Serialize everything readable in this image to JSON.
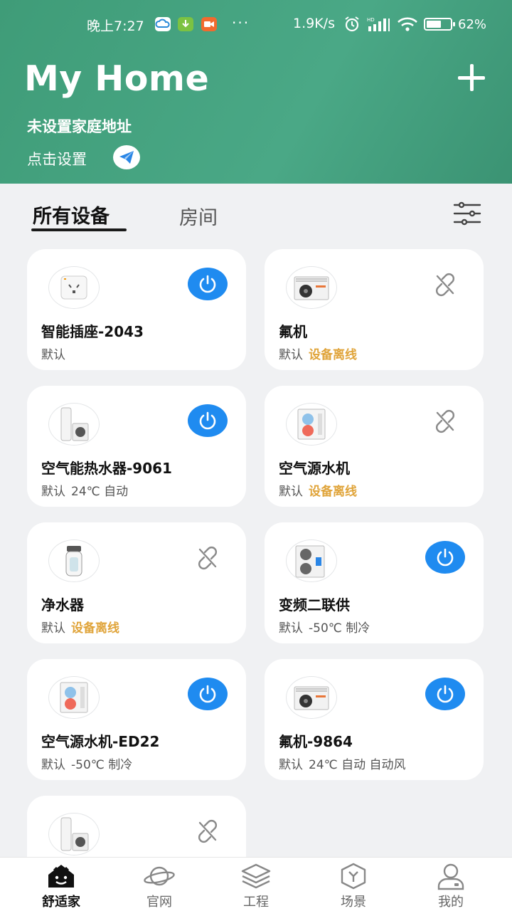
{
  "status_bar": {
    "time": "晚上7:27",
    "dots": "···",
    "speed": "1.9K/s",
    "battery_text": "62%",
    "battery_level": 0.62
  },
  "header": {
    "title": "My Home",
    "address": "未设置家庭地址",
    "setup_label": "点击设置"
  },
  "tabs": {
    "all_devices": "所有设备",
    "rooms": "房间"
  },
  "devices": [
    {
      "name": "智能插座-2043",
      "room": "默认",
      "status": "",
      "extra": "",
      "online": true,
      "icon": "smart-socket"
    },
    {
      "name": "氟机",
      "room": "默认",
      "status": "设备离线",
      "extra": "",
      "online": false,
      "icon": "ac-outdoor-unit"
    },
    {
      "name": "空气能热水器-9061",
      "room": "默认",
      "status": "",
      "extra": "24℃ 自动",
      "online": true,
      "icon": "heat-pump-water-heater"
    },
    {
      "name": "空气源水机",
      "room": "默认",
      "status": "设备离线",
      "extra": "",
      "online": false,
      "icon": "air-source-unit"
    },
    {
      "name": "净水器",
      "room": "默认",
      "status": "设备离线",
      "extra": "",
      "online": false,
      "icon": "water-purifier"
    },
    {
      "name": "变频二联供",
      "room": "默认",
      "status": "",
      "extra": "-50℃ 制冷",
      "online": true,
      "icon": "inverter-unit"
    },
    {
      "name": "空气源水机-ED22",
      "room": "默认",
      "status": "",
      "extra": "-50℃ 制冷",
      "online": true,
      "icon": "air-source-unit"
    },
    {
      "name": "氟机-9864",
      "room": "默认",
      "status": "",
      "extra": "24℃ 自动 自动风",
      "online": true,
      "icon": "ac-outdoor-unit"
    },
    {
      "name": "",
      "room": "",
      "status": "",
      "extra": "",
      "online": false,
      "icon": "heat-pump-water-heater"
    }
  ],
  "nav": [
    {
      "label": "舒适家",
      "icon": "home-smile-icon",
      "active": true
    },
    {
      "label": "官网",
      "icon": "planet-icon",
      "active": false
    },
    {
      "label": "工程",
      "icon": "layers-icon",
      "active": false
    },
    {
      "label": "场景",
      "icon": "cube-icon",
      "active": false
    },
    {
      "label": "我的",
      "icon": "user-icon",
      "active": false
    }
  ],
  "colors": {
    "header_green": "#45a27f",
    "power_blue": "#1f8bf0",
    "offline_orange": "#e0a43a"
  }
}
